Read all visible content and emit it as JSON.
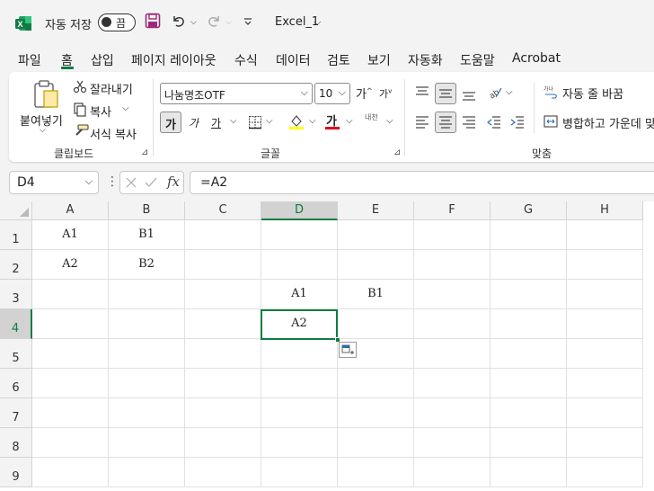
{
  "titlebar": {
    "autosave_label": "자동 저장",
    "toggle_label": "끔",
    "filename": "Excel_1"
  },
  "menu": [
    "파일",
    "홈",
    "삽입",
    "페이지 레이아웃",
    "수식",
    "데이터",
    "검토",
    "보기",
    "자동화",
    "도움말",
    "Acrobat"
  ],
  "ribbon": {
    "clipboard": {
      "paste": "붙여넣기",
      "cut": "잘라내기",
      "copy": "복사",
      "format_painter": "서식 복사",
      "label": "클립보드"
    },
    "font": {
      "name": "나눔명조OTF",
      "size": "10",
      "grow": "가",
      "shrink": "가",
      "bold": "가",
      "italic": "가",
      "underline": "가",
      "font_color_glyph": "가",
      "phonetic": "내천",
      "label": "글꼴"
    },
    "alignment": {
      "wrap_text": "자동 줄 바꿈",
      "merge_center": "병합하고 가운데 맞",
      "label": "맞춤"
    },
    "colors": {
      "highlight": "#ffff00",
      "font_color": "#e0001b",
      "accent": "#107c41"
    }
  },
  "formula_bar": {
    "name_box": "D4",
    "formula": "=A2",
    "fx": "fx"
  },
  "sheet": {
    "columns": [
      "A",
      "B",
      "C",
      "D",
      "E",
      "F",
      "G",
      "H"
    ],
    "rows": [
      "1",
      "2",
      "3",
      "4",
      "5",
      "6",
      "7",
      "8",
      "9"
    ],
    "selected_cell": "D4",
    "cells": {
      "A1": "A1",
      "B1": "B1",
      "A2": "A2",
      "B2": "B2",
      "D3": "A1",
      "E3": "B1",
      "D4": "A2"
    }
  }
}
